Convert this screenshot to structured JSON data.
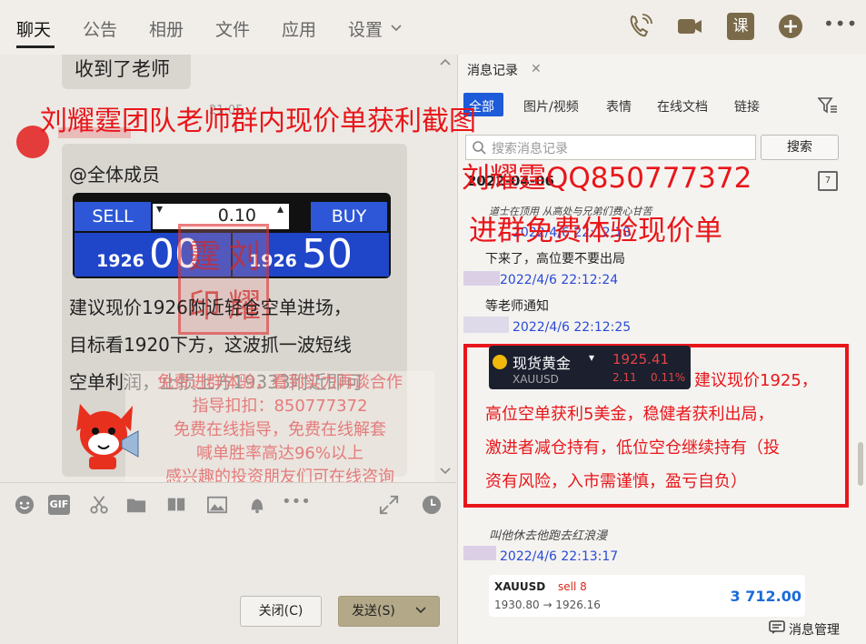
{
  "topbar": {
    "tabs": [
      "聊天",
      "公告",
      "相册",
      "文件",
      "应用",
      "设置"
    ],
    "kebab": "•••",
    "course_label": "课"
  },
  "chat": {
    "bubble1_text": "收到了老师",
    "time_partial": "21:05",
    "mention": "@全体成员",
    "trade_panel": {
      "sell_label": "SELL",
      "buy_label": "BUY",
      "lot": "0.10",
      "sell_small": "1926",
      "sell_big": "00",
      "buy_small": "1926",
      "buy_big": "50"
    },
    "advice_lines": [
      "建议现价1926附近轻仓空单进场，",
      "目标看1920下方，这波抓一波短线",
      "空单利润，止损上方19333附近即可"
    ],
    "promo_lines": [
      "免费进群体验，看到实力再谈合作",
      "指导扣扣：850777372",
      "免费在线指导，免费在线解套",
      "喊单胜率高达96%以上",
      "感兴趣的投资朋友们可在线咨询"
    ],
    "stamp_chars": [
      "霆",
      "刘",
      "印",
      "耀"
    ]
  },
  "watermark": {
    "title": "刘耀霆团队老师群内现价单获利截图",
    "qq": "刘耀霆QQ850777372",
    "join": "进群免费体验现价单"
  },
  "toolbar": {
    "gif": "GIF",
    "more": "•••",
    "close_label": "关闭(C)",
    "send_label": "发送(S)"
  },
  "history": {
    "panel_title": "消息记录",
    "filter_tabs": [
      "全部",
      "图片/视频",
      "表情",
      "在线文档",
      "链接"
    ],
    "search_placeholder": "搜索消息记录",
    "search_button": "搜索",
    "date": "2022-04-06",
    "calendar_day": "7",
    "cursive1": "道士在顶用  从高处与兄弟们费心甘苦",
    "ts1": "2022/4/6 22:12:18",
    "msg1": "下来了，高位要不要出局",
    "ts2": "2022/4/6 22:12:24",
    "msg2": "等老师通知",
    "ts3": "2022/4/6 22:12:25",
    "quote": {
      "name": "现货黄金",
      "symbol": "XAUUSD",
      "price": "1925.41",
      "change": "2.11",
      "pct": "0.11%"
    },
    "red_note": [
      "建议现价1925，",
      "高位空单获利5美金，稳健者获利出局，",
      "激进者减仓持有，低位空仓继续持有（投",
      "资有风险，入市需谨慎，盈亏自负）"
    ],
    "cursive2": "叫他休去他跑去红浪漫",
    "ts4": "2022/4/6 22:13:17",
    "trade_card": {
      "symbol": "XAUUSD",
      "side": "sell 8",
      "route": "1930.80 → 1926.16",
      "profit": "3 712.00"
    },
    "manage_label": "消息管理"
  },
  "colors": {
    "accent_blue": "#1e5bd8",
    "watermark_red": "#e8161a",
    "timestamp_blue": "#2a4bd7",
    "profit_blue": "#1a6bd8",
    "sell_red": "#d9281d",
    "send_button": "#b3a888"
  }
}
